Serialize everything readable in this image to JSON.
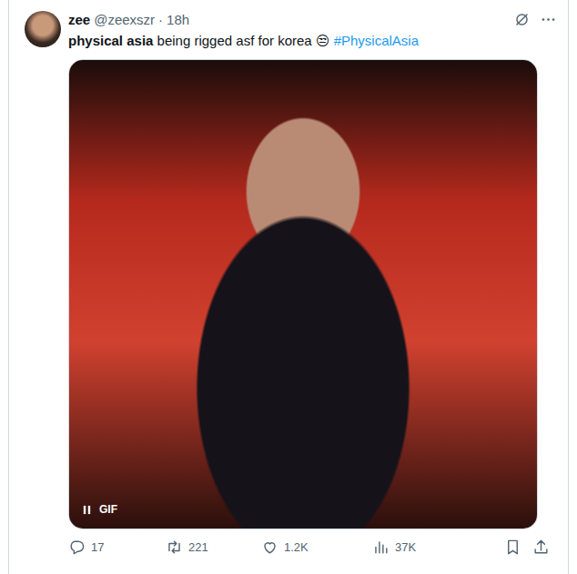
{
  "author": {
    "name": "zee",
    "handle": "@zeexszr",
    "separator": "·",
    "time": "18h"
  },
  "tweet": [
    {
      "text": "physical asia",
      "kind": "bold"
    },
    {
      "text": " being rigged asf for korea ",
      "kind": "plain"
    },
    {
      "text": "😒",
      "kind": "plain"
    },
    {
      "text": " ",
      "kind": "plain"
    },
    {
      "text": "#PhysicalAsia",
      "kind": "hashtag"
    }
  ],
  "media": {
    "badge": "GIF",
    "playing": true
  },
  "actions": [
    {
      "kind": "reply",
      "count": "17"
    },
    {
      "kind": "retweet",
      "count": "221"
    },
    {
      "kind": "like",
      "count": "1.2K"
    },
    {
      "kind": "views",
      "count": "37K"
    },
    {
      "kind": "bookmark",
      "count": ""
    },
    {
      "kind": "share",
      "count": ""
    }
  ]
}
